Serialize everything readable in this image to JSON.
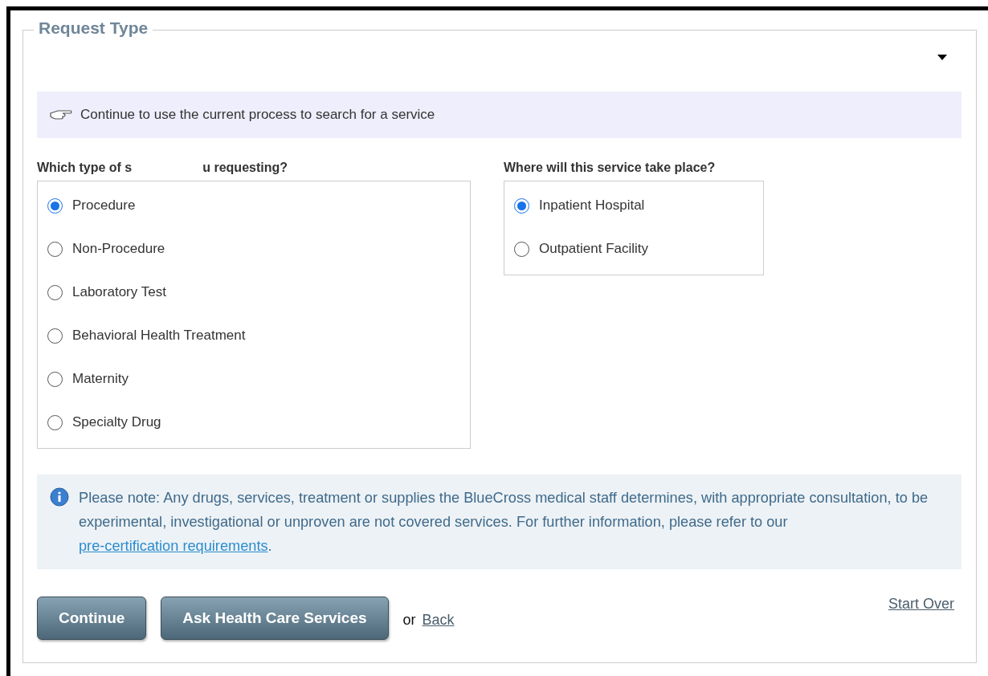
{
  "section": {
    "legend": "Request Type"
  },
  "banner": {
    "text": "Continue to use the current process to search for a service"
  },
  "service_type": {
    "question_start": "Which type of s",
    "question_end": "u requesting?",
    "options": [
      {
        "label": "Procedure",
        "selected": true
      },
      {
        "label": "Non-Procedure",
        "selected": false
      },
      {
        "label": "Laboratory Test",
        "selected": false
      },
      {
        "label": "Behavioral Health Treatment",
        "selected": false
      },
      {
        "label": "Maternity",
        "selected": false
      },
      {
        "label": "Specialty Drug",
        "selected": false
      }
    ]
  },
  "location": {
    "question": "Where will this service take place?",
    "options": [
      {
        "label": "Inpatient Hospital",
        "selected": true
      },
      {
        "label": "Outpatient Facility",
        "selected": false
      }
    ]
  },
  "note": {
    "text": "Please note: Any drugs, services, treatment or supplies the BlueCross medical staff determines, with appropriate consultation, to be experimental, investigational or unproven are not covered services. For further information, please refer to our ",
    "link": "pre-certification requirements",
    "end": "."
  },
  "buttons": [
    "Continue",
    "Ask Health Care Services"
  ],
  "or_text": "or",
  "back_link": "Back",
  "start_over_link": "Start Over"
}
